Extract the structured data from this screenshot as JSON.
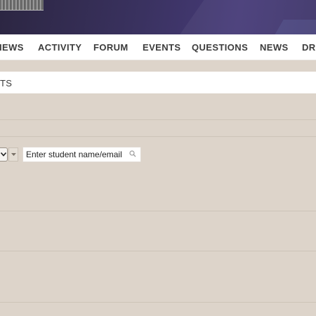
{
  "nav": {
    "items": [
      "IEWS",
      "ACTIVITY",
      "FORUM",
      "EVENTS",
      "QUESTIONS",
      "NEWS",
      "DRI"
    ]
  },
  "subheader": {
    "label": "TS"
  },
  "filters": {
    "select_icon": "chevron-down-icon",
    "dropdown_icon": "caret-down-icon",
    "search_placeholder": "Enter student name/email",
    "search_value": "",
    "search_icon": "search-icon"
  },
  "colors": {
    "banner": "#3a3260",
    "nav_background": "#ffffff",
    "nav_text": "#3c3c3c",
    "content_background": "#ddd4ca",
    "row_divider": "#cdc4b8"
  }
}
